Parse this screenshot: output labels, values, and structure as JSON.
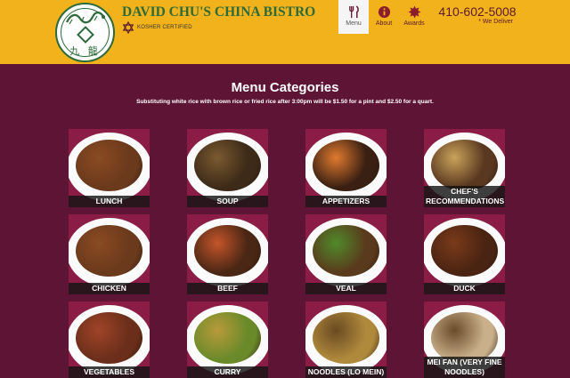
{
  "header": {
    "brand": "DAVID CHU'S CHINA BISTRO",
    "kosher_label": "KOSHER CERTIFIED",
    "logo_glyphs": "九 龍",
    "nav": [
      {
        "label": "Menu",
        "icon": "utensils-icon",
        "active": true
      },
      {
        "label": "About",
        "icon": "info-icon",
        "active": false
      },
      {
        "label": "Awards",
        "icon": "award-icon",
        "active": false
      }
    ],
    "phone": "410-602-5008",
    "delivery": "* We Deliver"
  },
  "main": {
    "title": "Menu Categories",
    "subtitle": "Substituting white rice with brown rice or fried rice after 3:00pm will be $1.50 for a pint and $2.50 for a quart."
  },
  "colors": {
    "header_bg": "#f2b21b",
    "page_bg": "#5e1535",
    "brand_green": "#2d6a3a",
    "accent_maroon": "#5a1a2c"
  },
  "categories": [
    {
      "label": "LUNCH",
      "icon": "chicken-dish-photo"
    },
    {
      "label": "SOUP",
      "icon": "soup-bowl-photo"
    },
    {
      "label": "APPETIZERS",
      "icon": "skewers-photo"
    },
    {
      "label": "CHEF'S RECOMMENDATIONS",
      "icon": "beef-noodle-photo"
    },
    {
      "label": "CHICKEN",
      "icon": "chicken-dish-photo"
    },
    {
      "label": "BEEF",
      "icon": "beef-stirfry-photo"
    },
    {
      "label": "VEAL",
      "icon": "veal-broccoli-photo"
    },
    {
      "label": "DUCK",
      "icon": "duck-dish-photo"
    },
    {
      "label": "VEGETABLES",
      "icon": "vegetable-dish-photo"
    },
    {
      "label": "CURRY",
      "icon": "curry-dish-photo"
    },
    {
      "label": "NOODLES (LO MEIN)",
      "icon": "lo-mein-photo"
    },
    {
      "label": "MEI FAN (VERY FINE NOODLES)",
      "icon": "mei-fan-photo"
    }
  ]
}
